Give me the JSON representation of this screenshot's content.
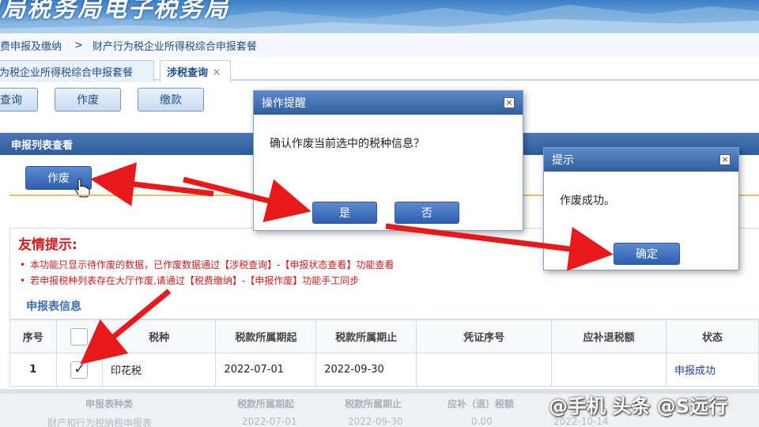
{
  "banner": {
    "title": "电局税务局电子税务局"
  },
  "breadcrumb": {
    "item1": "费申报及缴纳",
    "separator": ">",
    "item2": "财产行为税企业所得税综合申报套餐"
  },
  "tabs": [
    {
      "label": "为税企业所得税综合申报套餐"
    },
    {
      "label": "涉税查询",
      "close": "×"
    }
  ],
  "toolbar": {
    "query": "查询",
    "void": "作废",
    "pay": "缴款"
  },
  "panel": {
    "title": "申报列表查看",
    "void_button": "作废"
  },
  "tips": {
    "title": "友情提示:",
    "line1": "本功能只显示待作废的数据，已作废数据通过【涉税查询】-【申报状态查看】功能查看",
    "line2": "若申报税种列表存在大厅作废,请通过【税费缴纳】-【申报作废】功能手工同步"
  },
  "section": {
    "title": "申报表信息"
  },
  "table": {
    "headers": [
      "序号",
      "",
      "税种",
      "税款所属期起",
      "税款所属期止",
      "凭证序号",
      "应补退税额",
      "状态"
    ],
    "rows": [
      {
        "index": "1",
        "checked": true,
        "tax": "印花税",
        "start": "2022-07-01",
        "end": "2022-09-30",
        "voucher": "",
        "amount": "",
        "status": "申报成功"
      }
    ]
  },
  "bottom": {
    "headers": [
      "申报表种类",
      "税款所属期起",
      "税款所属期止",
      "应补（退）税额"
    ],
    "row_fragments": [
      "财产和行为税纳税申报表",
      "2022-07-01",
      "2022-09-30",
      "0.00",
      "2022-10-14"
    ]
  },
  "dialog_confirm": {
    "title": "操作提醒",
    "message": "确认作废当前选中的税种信息？",
    "yes": "是",
    "no": "否",
    "close": "×"
  },
  "dialog_info": {
    "title": "提示",
    "message": "作废成功。",
    "ok": "确定",
    "close": "×"
  },
  "watermark": "头条 @S远行",
  "watermark_prefix": "@手机",
  "colors": {
    "arrow": "#e8191b",
    "header": "#2f5e9f",
    "tip_red": "#cc1d1d",
    "link": "#1d3f9a"
  }
}
